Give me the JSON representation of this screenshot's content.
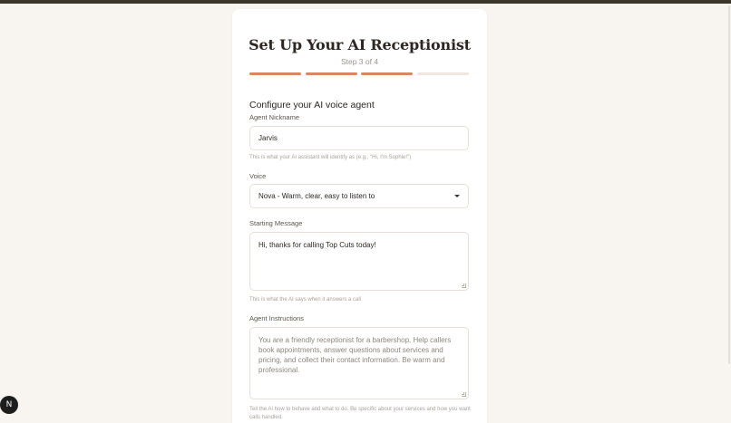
{
  "header": {
    "title": "Set Up Your AI Receptionist",
    "step": "Step 3 of 4"
  },
  "progress": {
    "current_step": 3,
    "total_steps": 4
  },
  "section_title": "Configure your AI voice agent",
  "fields": {
    "nickname": {
      "label": "Agent Nickname",
      "value": "Jarvis",
      "hint": "This is what your AI assistant will identify as (e.g., \"Hi, I'm Sophie!\")"
    },
    "voice": {
      "label": "Voice",
      "selected": "Nova - Warm, clear, easy to listen to"
    },
    "starting_message": {
      "label": "Starting Message",
      "value": "Hi, thanks for calling Top Cuts today!",
      "hint": "This is what the AI says when it answers a call"
    },
    "instructions": {
      "label": "Agent Instructions",
      "placeholder": "You are a friendly receptionist for a barbershop. Help callers book appointments, answer questions about services and pricing, and collect their contact information. Be warm and professional.",
      "hint": "Tell the AI how to behave and what to do. Be specific about your services and how you want calls handled."
    }
  },
  "devtools_badge": "N",
  "colors": {
    "accent": "#d48a5e",
    "background": "#f8f5f1",
    "card": "#ffffff"
  }
}
